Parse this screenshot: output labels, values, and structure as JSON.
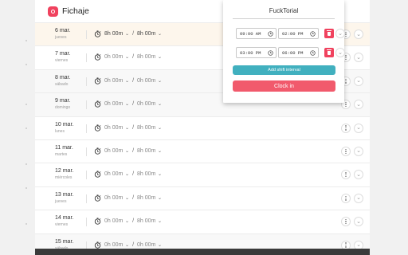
{
  "app": {
    "title": "Fichaje"
  },
  "days": [
    {
      "date": "6 mar.",
      "weekday": "jueves",
      "worked": "8h 00m",
      "expected": "8h 00m",
      "variant": "today"
    },
    {
      "date": "7 mar.",
      "weekday": "viernes",
      "worked": "0h 00m",
      "expected": "8h 00m",
      "variant": "normal"
    },
    {
      "date": "8 mar.",
      "weekday": "sábado",
      "worked": "0h 00m",
      "expected": "0h 00m",
      "variant": "weekend"
    },
    {
      "date": "9 mar.",
      "weekday": "domingo",
      "worked": "0h 00m",
      "expected": "0h 00m",
      "variant": "weekend"
    },
    {
      "date": "10 mar.",
      "weekday": "lunes",
      "worked": "0h 00m",
      "expected": "8h 00m",
      "variant": "normal"
    },
    {
      "date": "11 mar.",
      "weekday": "martes",
      "worked": "0h 00m",
      "expected": "8h 00m",
      "variant": "normal"
    },
    {
      "date": "12 mar.",
      "weekday": "miércoles",
      "worked": "0h 00m",
      "expected": "8h 00m",
      "variant": "normal"
    },
    {
      "date": "13 mar.",
      "weekday": "jueves",
      "worked": "0h 00m",
      "expected": "8h 00m",
      "variant": "normal"
    },
    {
      "date": "14 mar.",
      "weekday": "viernes",
      "worked": "0h 00m",
      "expected": "8h 00m",
      "variant": "normal"
    },
    {
      "date": "15 mar.",
      "weekday": "sábado",
      "worked": "0h 00m",
      "expected": "0h 00m",
      "variant": "weekend"
    }
  ],
  "popup": {
    "title": "FuckTorial",
    "shifts": [
      {
        "start": "09:00 AM",
        "end": "02:00 PM"
      },
      {
        "start": "03:00 PM",
        "end": "06:00 PM"
      }
    ],
    "add_label": "Add shift interval",
    "clock_in_label": "Clock in"
  },
  "colors": {
    "accent": "#f0425e",
    "teal": "#41b0bf",
    "clock_in": "#f15a6c"
  }
}
